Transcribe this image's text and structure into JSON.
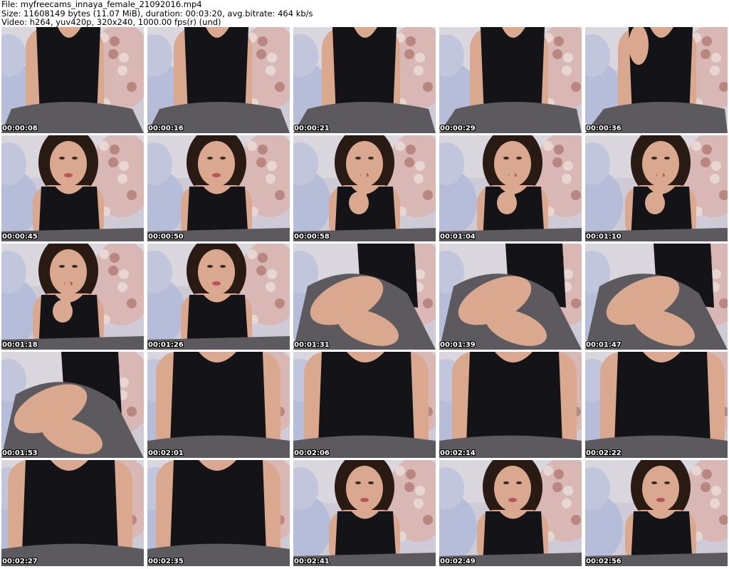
{
  "header": {
    "file_line": "File: myfreecams_innaya_female_21092016.mp4",
    "size_line": "Size: 11608149 bytes (11.07 MiB), duration: 00:03:20, avg.bitrate: 464 kb/s",
    "video_line": "Video: h264, yuv420p, 320x240, 1000.00 fps(r) (und)"
  },
  "thumbnails": [
    {
      "time": "00:00:08"
    },
    {
      "time": "00:00:16"
    },
    {
      "time": "00:00:21"
    },
    {
      "time": "00:00:29"
    },
    {
      "time": "00:00:36"
    },
    {
      "time": "00:00:45"
    },
    {
      "time": "00:00:50"
    },
    {
      "time": "00:00:58"
    },
    {
      "time": "00:01:04"
    },
    {
      "time": "00:01:10"
    },
    {
      "time": "00:01:18"
    },
    {
      "time": "00:01:26"
    },
    {
      "time": "00:01:31"
    },
    {
      "time": "00:01:39"
    },
    {
      "time": "00:01:47"
    },
    {
      "time": "00:01:53"
    },
    {
      "time": "00:02:01"
    },
    {
      "time": "00:02:06"
    },
    {
      "time": "00:02:14"
    },
    {
      "time": "00:02:22"
    },
    {
      "time": "00:02:27"
    },
    {
      "time": "00:02:35"
    },
    {
      "time": "00:02:41"
    },
    {
      "time": "00:02:49"
    },
    {
      "time": "00:02:56"
    }
  ]
}
